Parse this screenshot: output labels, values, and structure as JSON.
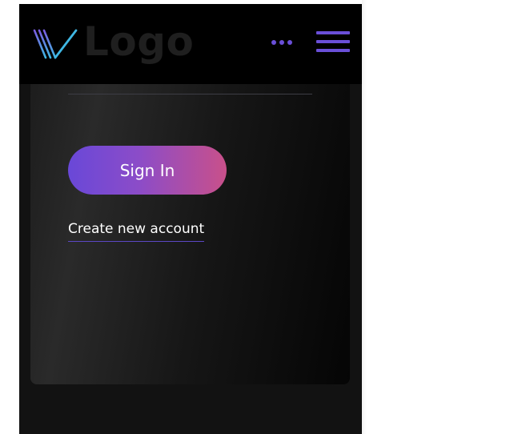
{
  "header": {
    "logo_text": "Logo",
    "accent_color": "#6a4fd8",
    "icons": {
      "logo_mark": "stylized-w-logo-icon",
      "more": "more-dots-icon",
      "menu": "hamburger-menu-icon"
    }
  },
  "form": {
    "sign_in_label": "Sign In",
    "create_account_label": "Create new account",
    "button_gradient": [
      "#6948d8",
      "#c9508a"
    ]
  }
}
